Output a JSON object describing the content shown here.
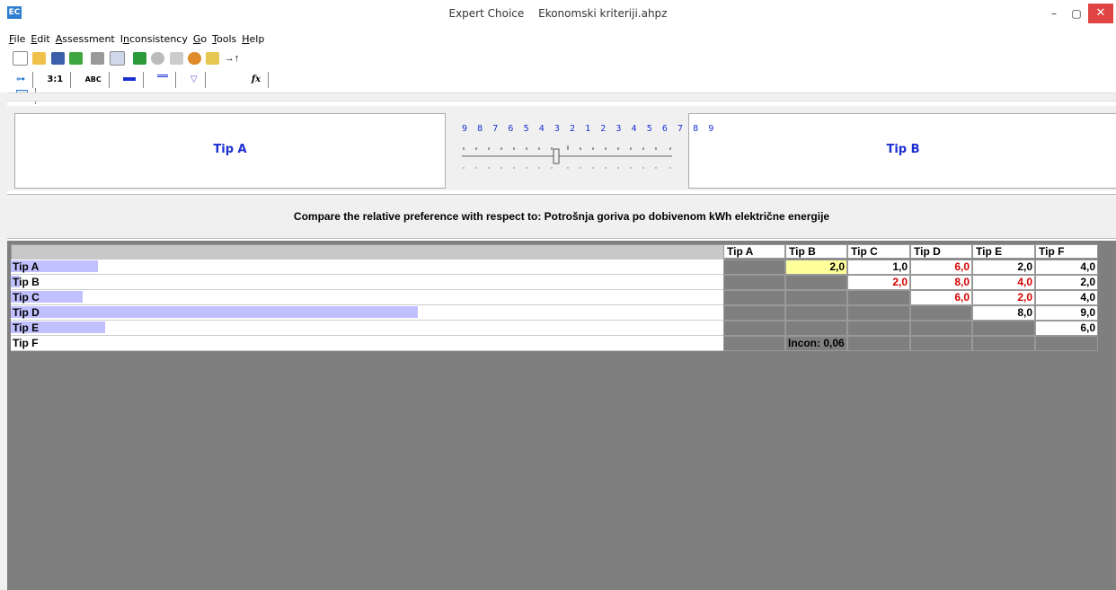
{
  "window": {
    "app_name": "Expert Choice",
    "file_name": "Ekonomski kriteriji.ahpz",
    "minimize": "–",
    "maximize": "▢",
    "close": "✕"
  },
  "menu": [
    {
      "label": "File",
      "accel": "F"
    },
    {
      "label": "Edit",
      "accel": "E"
    },
    {
      "label": "Assessment",
      "accel": "A"
    },
    {
      "label": "Inconsistency",
      "accel": "n"
    },
    {
      "label": "Go",
      "accel": "G"
    },
    {
      "label": "Tools",
      "accel": "T"
    },
    {
      "label": "Help",
      "accel": "H"
    }
  ],
  "toolbar2_tabs": [
    "3:1",
    "ABC"
  ],
  "compare": {
    "left_item": "Tip A",
    "right_item": "Tip B",
    "scale_numbers": "9 8 7 6 5 4 3 2 1 2 3 4 5 6 7 8 9",
    "prompt": "Compare the relative preference with respect to: Potrošnja goriva po dobivenom kWh električne energije"
  },
  "matrix": {
    "columns": [
      "Tip A",
      "Tip B",
      "Tip C",
      "Tip D",
      "Tip E",
      "Tip F"
    ],
    "rows": [
      {
        "label": "Tip A",
        "bar_fraction": 0.122
      },
      {
        "label": "Tip B",
        "bar_fraction": 0.013
      },
      {
        "label": "Tip C",
        "bar_fraction": 0.101
      },
      {
        "label": "Tip D",
        "bar_fraction": 0.571
      },
      {
        "label": "Tip E",
        "bar_fraction": 0.132
      },
      {
        "label": "Tip F",
        "bar_fraction": 0.0
      }
    ],
    "cells": [
      [
        null,
        "2,0",
        "1,0",
        "6,0",
        "2,0",
        "4,0"
      ],
      [
        null,
        null,
        "2,0",
        "8,0",
        "4,0",
        "2,0"
      ],
      [
        null,
        null,
        null,
        "6,0",
        "2,0",
        "4,0"
      ],
      [
        null,
        null,
        null,
        null,
        "8,0",
        "9,0"
      ],
      [
        null,
        null,
        null,
        null,
        null,
        "6,0"
      ],
      [
        null,
        null,
        null,
        null,
        null,
        null
      ]
    ],
    "inconsistency": "Incon: 0,06"
  },
  "colors": {
    "accent_blue": "#1c2fd0",
    "inverse_red": "#d40000",
    "bar_fill": "#c0c0ff",
    "selected_cell": "#ffff9c",
    "gray_bg": "#7f7f7f"
  }
}
